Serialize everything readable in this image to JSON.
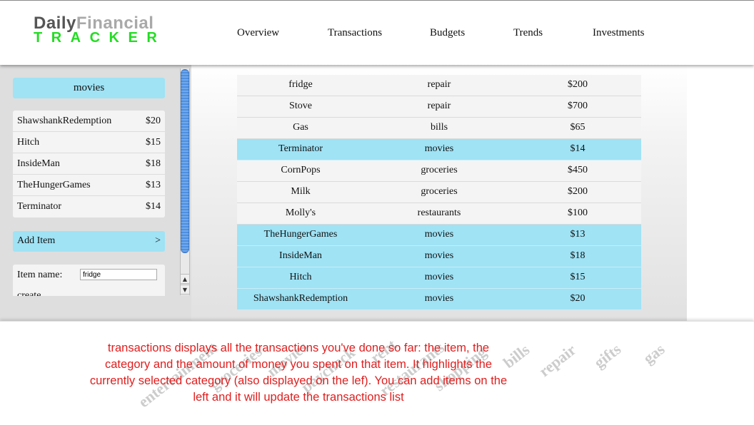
{
  "logo": {
    "line1_a": "Daily",
    "line1_b": "Financial",
    "line2": "TRACKER"
  },
  "nav": [
    "Overview",
    "Transactions",
    "Budgets",
    "Trends",
    "Investments"
  ],
  "sidebar": {
    "selected_category": "movies",
    "items": [
      {
        "name": "ShawshankRedemption",
        "amount": "$20"
      },
      {
        "name": "Hitch",
        "amount": "$15"
      },
      {
        "name": "InsideMan",
        "amount": "$18"
      },
      {
        "name": "TheHungerGames",
        "amount": "$13"
      },
      {
        "name": "Terminator",
        "amount": "$14"
      }
    ],
    "add_item_label": "Add Item",
    "add_item_chevron": ">",
    "form": {
      "item_name_label": "Item name:",
      "item_name_value": "fridge",
      "second_label": "create"
    }
  },
  "scrollbar": {
    "up": "▲",
    "down": "▼"
  },
  "transactions": [
    {
      "item": "fridge",
      "category": "repair",
      "amount": "$200",
      "highlighted": false
    },
    {
      "item": "Stove",
      "category": "repair",
      "amount": "$700",
      "highlighted": false
    },
    {
      "item": "Gas",
      "category": "bills",
      "amount": "$65",
      "highlighted": false
    },
    {
      "item": "Terminator",
      "category": "movies",
      "amount": "$14",
      "highlighted": true
    },
    {
      "item": "CornPops",
      "category": "groceries",
      "amount": "$450",
      "highlighted": false
    },
    {
      "item": "Milk",
      "category": "groceries",
      "amount": "$200",
      "highlighted": false
    },
    {
      "item": "Molly's",
      "category": "restaurants",
      "amount": "$100",
      "highlighted": false
    },
    {
      "item": "TheHungerGames",
      "category": "movies",
      "amount": "$13",
      "highlighted": true
    },
    {
      "item": "InsideMan",
      "category": "movies",
      "amount": "$18",
      "highlighted": true
    },
    {
      "item": "Hitch",
      "category": "movies",
      "amount": "$15",
      "highlighted": true
    },
    {
      "item": "ShawshankRedemption",
      "category": "movies",
      "amount": "$20",
      "highlighted": true
    }
  ],
  "category_words": [
    "entertainment",
    "groceries",
    "movies",
    "paycheck",
    "rent",
    "restaurants",
    "shopping",
    "bills",
    "repair",
    "gifts",
    "gas"
  ],
  "annotation": "transactions displays all the transactions you've done so far: the item, the category and the amount of money you spent on that item. It highlights the currently selected category (also displayed on the lef). You can add items on the left and it will update the transactions list",
  "colors": {
    "highlight": "#9fe3f5",
    "logo_green": "#22dd22",
    "annotation": "#e01e1e",
    "scroll_thumb": "#4f8fe0"
  }
}
